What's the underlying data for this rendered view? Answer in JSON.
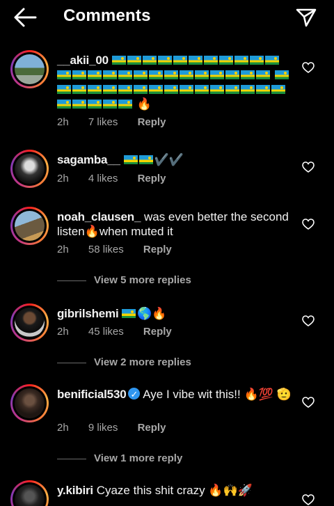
{
  "header": {
    "title": "Comments",
    "back_icon": "back-arrow-icon",
    "send_icon": "paper-plane-icon"
  },
  "comments": [
    {
      "username": "__akii_00",
      "text": "🔥",
      "flag_count": 37,
      "time": "2h",
      "likes": "7 likes",
      "reply": "Reply"
    },
    {
      "username": "sagamba__",
      "text": "✔️✔️",
      "flag_count": 2,
      "time": "2h",
      "likes": "4 likes",
      "reply": "Reply"
    },
    {
      "username": "noah_clausen_",
      "text": "was even better the second listen🔥when muted it",
      "time": "2h",
      "likes": "58 likes",
      "reply": "Reply",
      "view_more": "View 5 more replies"
    },
    {
      "username": "gibrilshemi",
      "text": "🌎🔥",
      "flag_count": 1,
      "time": "2h",
      "likes": "45 likes",
      "reply": "Reply",
      "view_more": "View 2 more replies"
    },
    {
      "username": "benificial530",
      "verified": true,
      "text": "Aye I vibe wit this!! 🔥💯 🫡",
      "time": "2h",
      "likes": "9 likes",
      "reply": "Reply",
      "view_more": "View 1 more reply"
    },
    {
      "username": "y.kibiri",
      "text": "Cyaze this shit crazy 🔥🙌🚀"
    }
  ]
}
